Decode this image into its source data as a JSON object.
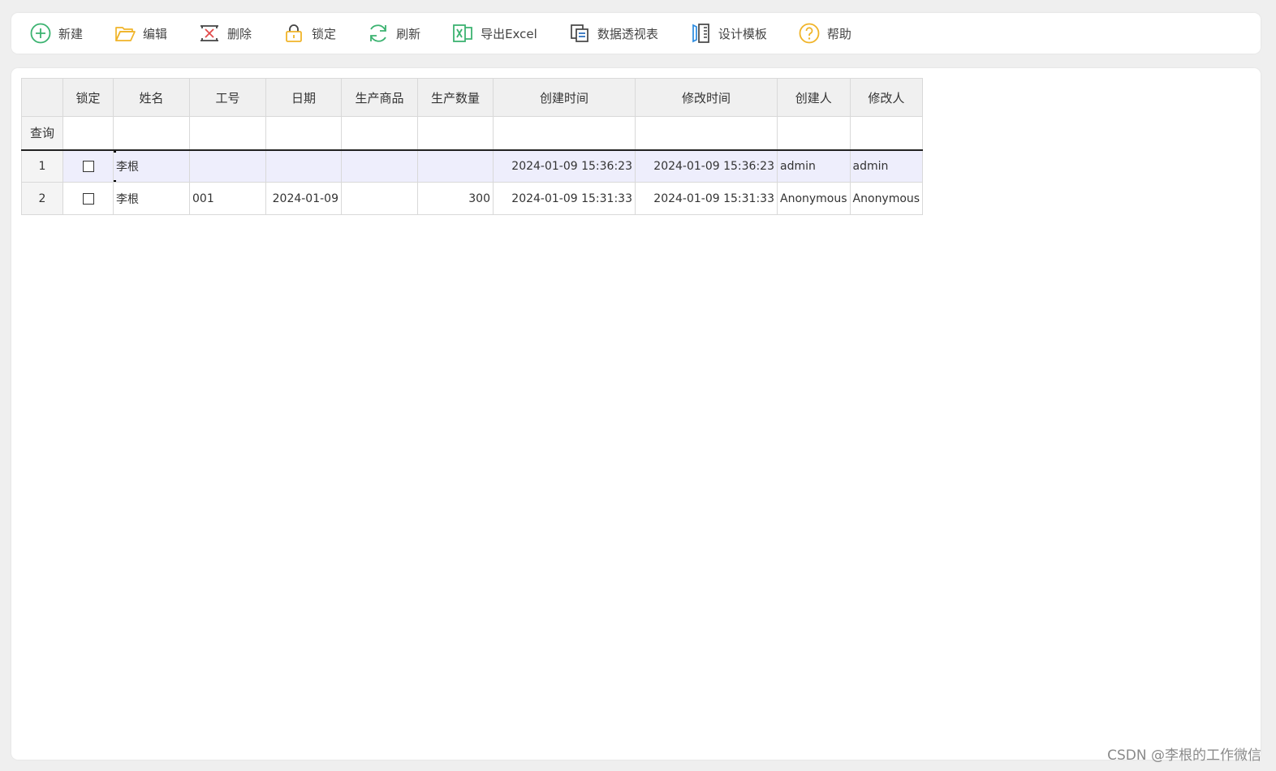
{
  "toolbar": {
    "buttons": [
      {
        "label": "新建",
        "icon": "plus-circle-icon",
        "color": "#3cb371"
      },
      {
        "label": "编辑",
        "icon": "folder-open-icon",
        "color": "#f0b429"
      },
      {
        "label": "删除",
        "icon": "delete-icon",
        "color": "#e24b4b"
      },
      {
        "label": "锁定",
        "icon": "lock-icon",
        "color": "#f0b429"
      },
      {
        "label": "刷新",
        "icon": "refresh-icon",
        "color": "#3cb371"
      },
      {
        "label": "导出Excel",
        "icon": "excel-icon",
        "color": "#3cb371"
      },
      {
        "label": "数据透视表",
        "icon": "pivot-table-icon",
        "color": "#2a6fbf"
      },
      {
        "label": "设计模板",
        "icon": "design-template-icon",
        "color": "#2a8be0"
      },
      {
        "label": "帮助",
        "icon": "help-icon",
        "color": "#f0b429"
      }
    ]
  },
  "grid": {
    "columns": [
      "锁定",
      "姓名",
      "工号",
      "日期",
      "生产商品",
      "生产数量",
      "创建时间",
      "修改时间",
      "创建人",
      "修改人"
    ],
    "filter_label": "查询",
    "rows": [
      {
        "no": "1",
        "locked": false,
        "name": "李根",
        "emp_no": "",
        "date": "",
        "product": "",
        "qty": "",
        "created": "2024-01-09 15:36:23",
        "modified": "2024-01-09 15:36:23",
        "creator": "admin",
        "modifier": "admin"
      },
      {
        "no": "2",
        "locked": false,
        "name": "李根",
        "emp_no": "001",
        "date": "2024-01-09",
        "product": "",
        "qty": "300",
        "created": "2024-01-09 15:31:33",
        "modified": "2024-01-09 15:31:33",
        "creator": "Anonymous",
        "modifier": "Anonymous"
      }
    ]
  },
  "watermark": "CSDN @李根的工作微信"
}
